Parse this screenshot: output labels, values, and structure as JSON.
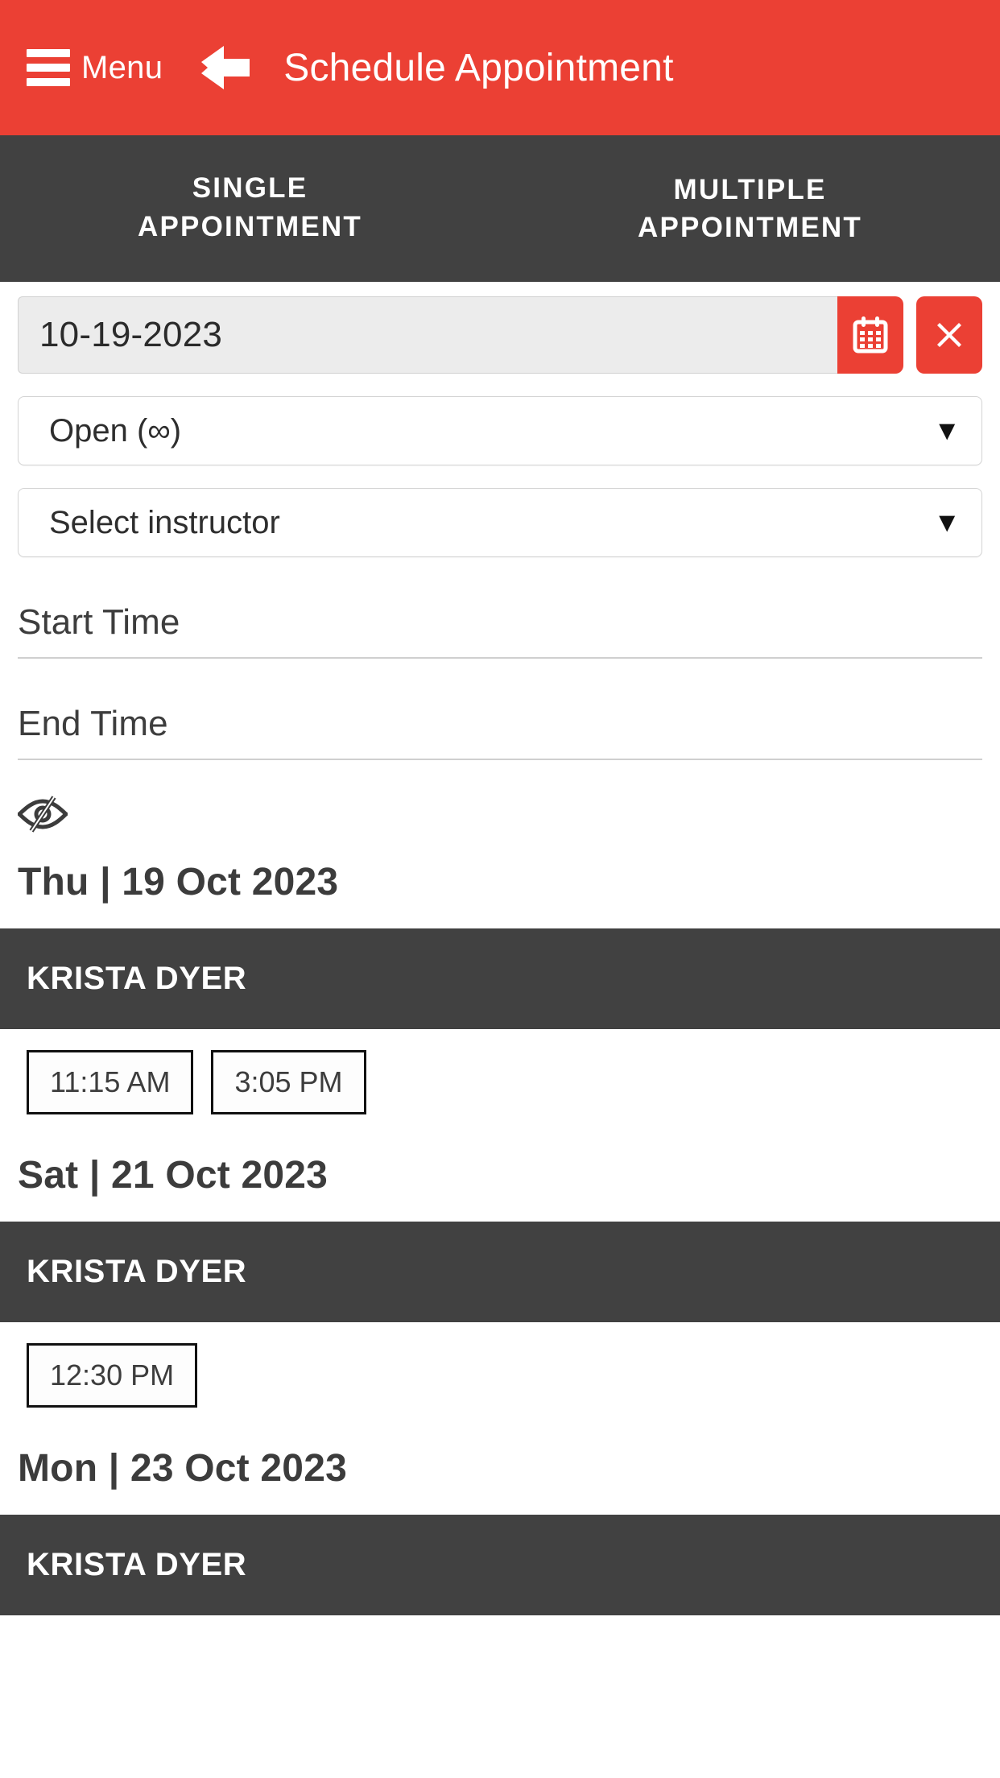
{
  "theme": {
    "accent": "#eb4034",
    "dark": "#414141",
    "text": "#3c3c3c"
  },
  "appbar": {
    "menu_label": "Menu",
    "menu_icon": "hamburger-icon",
    "back_icon": "arrow-left-icon",
    "title": "Schedule Appointment"
  },
  "tabs": [
    {
      "line1": "SINGLE",
      "line2": "APPOINTMENT",
      "active": true
    },
    {
      "line1": "MULTIPLE",
      "line2": "APPOINTMENT",
      "active": false
    }
  ],
  "form": {
    "date": {
      "value": "10-19-2023",
      "placeholder": "MM-DD-YYYY"
    },
    "calendar_icon": "calendar-icon",
    "clear_icon": "close-x-icon",
    "duration_select": {
      "value": "Open (∞)",
      "chevron": "⌄"
    },
    "instructor_select": {
      "value": "Select instructor",
      "chevron": "⌄"
    },
    "start_time": {
      "label": "Start Time",
      "value": ""
    },
    "end_time": {
      "label": "End Time",
      "value": ""
    },
    "visibility_toggle_icon": "eye-slash-icon"
  },
  "results": [
    {
      "day": "Thu | 19 Oct 2023",
      "instructor": "KRISTA DYER",
      "slots": [
        "11:15 AM",
        "3:05 PM"
      ]
    },
    {
      "day": "Sat | 21 Oct 2023",
      "instructor": "KRISTA DYER",
      "slots": [
        "12:30 PM"
      ]
    },
    {
      "day": "Mon | 23 Oct 2023",
      "instructor": "KRISTA DYER",
      "slots": []
    }
  ]
}
